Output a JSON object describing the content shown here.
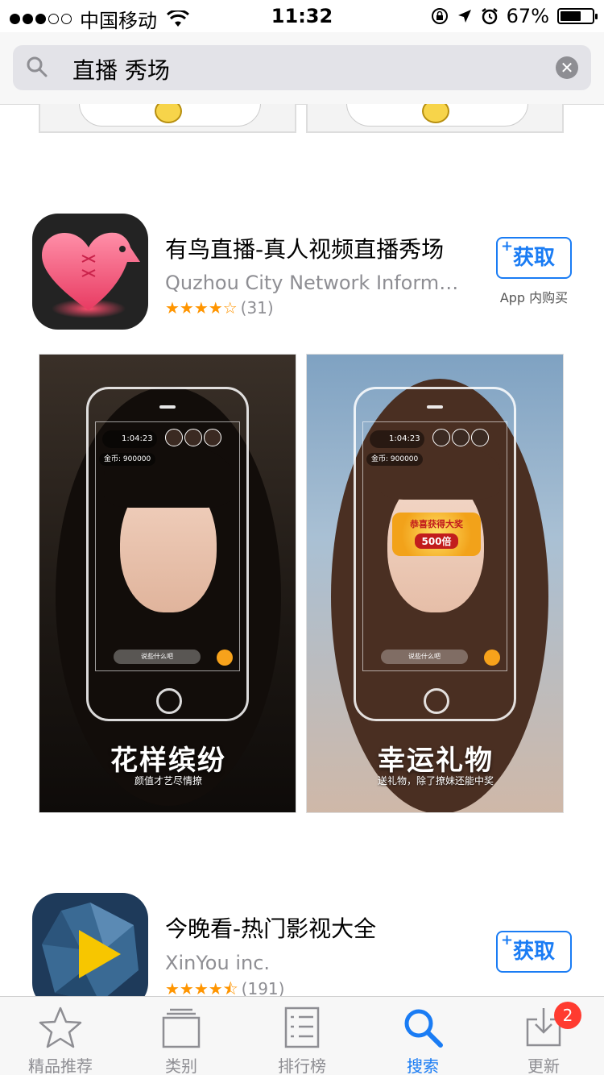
{
  "status": {
    "carrier": "中国移动",
    "time": "11:32",
    "battery_pct": "67%",
    "battery_level": 0.67,
    "signal_bars": 3,
    "signal_max": 5
  },
  "search": {
    "query": "直播  秀场"
  },
  "apps": [
    {
      "title": "有鸟直播-真人视频直播秀场",
      "developer": "Quzhou City Network Informat...",
      "stars": "★★★★☆",
      "rating_value": 4,
      "rating_count": "(31)",
      "get_label": "获取",
      "iap_label": "App 内购买"
    },
    {
      "title": "今晚看-热门影视大全",
      "developer": "XinYou inc.",
      "stars": "★★★★⯪",
      "rating_value": 4.5,
      "rating_count": "(191)",
      "get_label": "获取"
    }
  ],
  "screenshots": [
    {
      "caption": "花样缤纷",
      "subcaption": "颜值才艺尽情撩",
      "timer": "1:04:23",
      "coins": "金币: 900000",
      "message_hint": "说些什么吧"
    },
    {
      "caption": "幸运礼物",
      "subcaption": "送礼物，除了撩妹还能中奖",
      "timer": "1:04:23",
      "coins": "金币: 900000",
      "message_hint": "说些什么吧",
      "prize_banner": "恭喜获得大奖",
      "prize_multiplier": "500倍"
    }
  ],
  "tabs": [
    {
      "label": "精品推荐",
      "icon": "star-icon"
    },
    {
      "label": "类别",
      "icon": "categories-icon"
    },
    {
      "label": "排行榜",
      "icon": "top-charts-icon"
    },
    {
      "label": "搜索",
      "icon": "search-icon",
      "active": true
    },
    {
      "label": "更新",
      "icon": "updates-icon",
      "badge": "2"
    }
  ],
  "colors": {
    "accent": "#1a7cf4",
    "star": "#ff9500",
    "badge": "#ff3b30"
  }
}
